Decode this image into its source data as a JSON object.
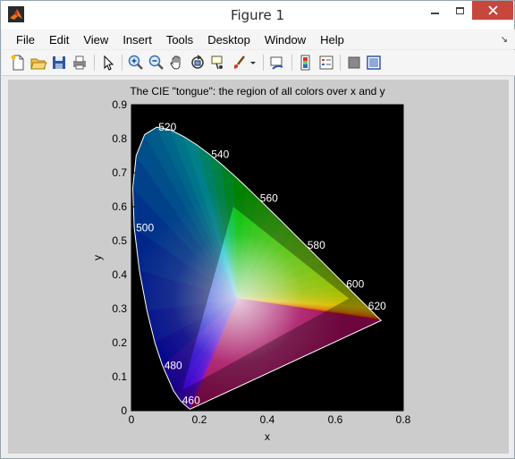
{
  "window": {
    "title": "Figure 1",
    "colors": {
      "close": "#c7473d",
      "figure_bg": "#cccccc",
      "plot_bg": "#000000"
    }
  },
  "menu": [
    "File",
    "Edit",
    "View",
    "Insert",
    "Tools",
    "Desktop",
    "Window",
    "Help"
  ],
  "toolbar": {
    "icons": [
      "new-figure-icon",
      "open-file-icon",
      "save-icon",
      "print-icon",
      "pointer-icon",
      "zoom-in-icon",
      "zoom-out-icon",
      "pan-icon",
      "rotate-3d-icon",
      "data-cursor-icon",
      "brush-icon",
      "brush-menu-icon",
      "link-plot-icon",
      "insert-colorbar-icon",
      "insert-legend-icon",
      "hide-plot-tools-icon",
      "show-plot-tools-icon"
    ]
  },
  "chart_data": {
    "type": "scatter",
    "title": "The CIE \"tongue\": the region of all colors over x and y",
    "xlabel": "x",
    "ylabel": "y",
    "xlim": [
      0,
      0.8
    ],
    "ylim": [
      0,
      0.9
    ],
    "xticks": [
      "0",
      "0.2",
      "0.4",
      "0.6",
      "0.8"
    ],
    "yticks": [
      "0",
      "0.1",
      "0.2",
      "0.3",
      "0.4",
      "0.5",
      "0.6",
      "0.7",
      "0.8",
      "0.9"
    ],
    "xtick_values": [
      0,
      0.2,
      0.4,
      0.6,
      0.8
    ],
    "ytick_values": [
      0,
      0.1,
      0.2,
      0.3,
      0.4,
      0.5,
      0.6,
      0.7,
      0.8,
      0.9
    ],
    "boundary": {
      "x": [
        0.1741,
        0.1738,
        0.1736,
        0.1733,
        0.1726,
        0.1714,
        0.1689,
        0.1644,
        0.1566,
        0.144,
        0.1241,
        0.0913,
        0.0687,
        0.0454,
        0.0235,
        0.0082,
        0.0039,
        0.0139,
        0.0389,
        0.0743,
        0.1142,
        0.1547,
        0.1929,
        0.2296,
        0.2658,
        0.3016,
        0.3373,
        0.3731,
        0.4087,
        0.4441,
        0.4788,
        0.5125,
        0.5448,
        0.5752,
        0.6029,
        0.627,
        0.6482,
        0.6658,
        0.6801,
        0.6915,
        0.7006,
        0.7079,
        0.714,
        0.719,
        0.723,
        0.726,
        0.7283,
        0.73,
        0.7311,
        0.732,
        0.7327,
        0.7334,
        0.734,
        0.7344,
        0.7346,
        0.7347
      ],
      "y": [
        0.005,
        0.0049,
        0.0049,
        0.0048,
        0.0048,
        0.0051,
        0.0069,
        0.0109,
        0.0177,
        0.0297,
        0.0578,
        0.1327,
        0.2007,
        0.295,
        0.4127,
        0.5384,
        0.6548,
        0.7502,
        0.812,
        0.8338,
        0.8262,
        0.8059,
        0.7816,
        0.7543,
        0.7243,
        0.6923,
        0.6589,
        0.6245,
        0.5896,
        0.5547,
        0.5202,
        0.4866,
        0.4544,
        0.4242,
        0.3965,
        0.3725,
        0.3514,
        0.334,
        0.3197,
        0.3083,
        0.2993,
        0.292,
        0.2859,
        0.2809,
        0.277,
        0.274,
        0.2717,
        0.27,
        0.2689,
        0.268,
        0.2673,
        0.2666,
        0.266,
        0.2656,
        0.2654,
        0.2653
      ]
    },
    "gamut_triangle": {
      "x": [
        0.64,
        0.3,
        0.15
      ],
      "y": [
        0.33,
        0.6,
        0.06
      ]
    },
    "wavelength_labels": [
      {
        "text": "460",
        "x": 0.144,
        "y": 0.0297
      },
      {
        "text": "480",
        "x": 0.0913,
        "y": 0.1327
      },
      {
        "text": "500",
        "x": 0.0082,
        "y": 0.5384
      },
      {
        "text": "520",
        "x": 0.0743,
        "y": 0.8338
      },
      {
        "text": "540",
        "x": 0.2296,
        "y": 0.7543
      },
      {
        "text": "560",
        "x": 0.3731,
        "y": 0.6245
      },
      {
        "text": "580",
        "x": 0.5125,
        "y": 0.4866
      },
      {
        "text": "600",
        "x": 0.627,
        "y": 0.3725
      },
      {
        "text": "620",
        "x": 0.6915,
        "y": 0.3083
      }
    ]
  }
}
